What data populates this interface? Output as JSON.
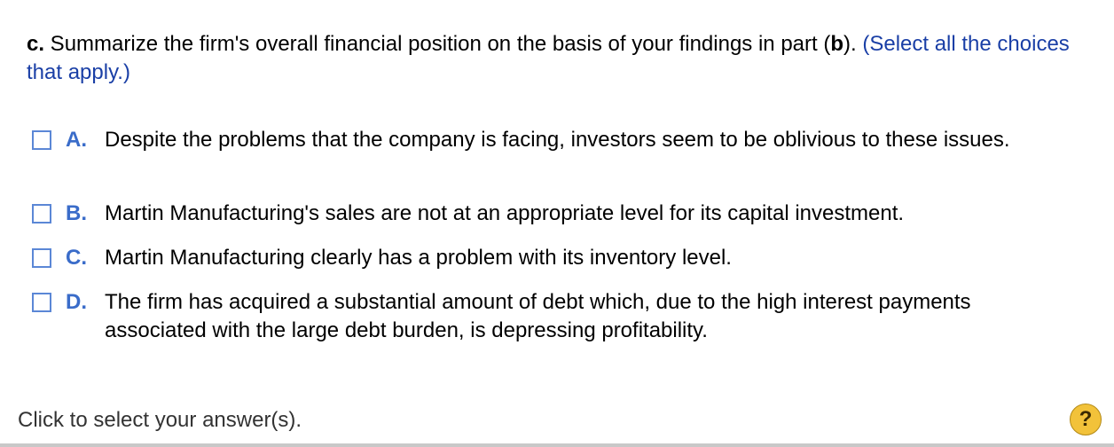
{
  "question": {
    "part": "c.",
    "text_before": " Summarize the firm's overall financial position on the basis of your findings in part (",
    "bold_ref": "b",
    "text_after": "). ",
    "note": "(Select all the choices that apply.)"
  },
  "choices": [
    {
      "letter": "A.",
      "text": "Despite the problems that the company is facing, investors seem to be oblivious to these issues."
    },
    {
      "letter": "B.",
      "text": "Martin Manufacturing's sales are not at an appropriate level for its capital investment."
    },
    {
      "letter": "C.",
      "text": "Martin Manufacturing clearly has a problem with its inventory level."
    },
    {
      "letter": "D.",
      "text": "The firm has acquired a substantial amount of debt which, due to the high interest payments associated with the large debt burden, is depressing profitability."
    }
  ],
  "footer": {
    "prompt": "Click to select your answer(s).",
    "help_label": "?",
    "help_icon": "question-mark-icon"
  }
}
